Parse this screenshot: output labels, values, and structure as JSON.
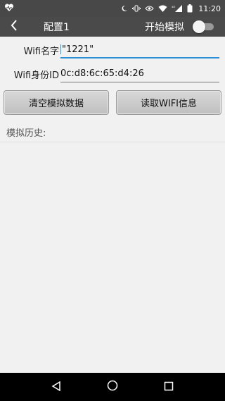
{
  "status_bar": {
    "time": "11:20",
    "network": "4G"
  },
  "app_bar": {
    "title": "配置1",
    "toggle_label": "开始模拟",
    "toggle_on": false
  },
  "form": {
    "wifi_name_label": "Wifi名字",
    "wifi_name_value": "\"1221\"",
    "wifi_id_label": "Wifi身份ID",
    "wifi_id_value": "0c:d8:6c:65:d4:26"
  },
  "buttons": {
    "clear_label": "清空模拟数据",
    "read_label": "读取WIFI信息"
  },
  "history": {
    "label": "模拟历史:"
  },
  "colors": {
    "app_bar": "#4a4a4a",
    "status_bar": "#484848",
    "accent": "#2b8fd6",
    "background": "#f1f1f1"
  }
}
